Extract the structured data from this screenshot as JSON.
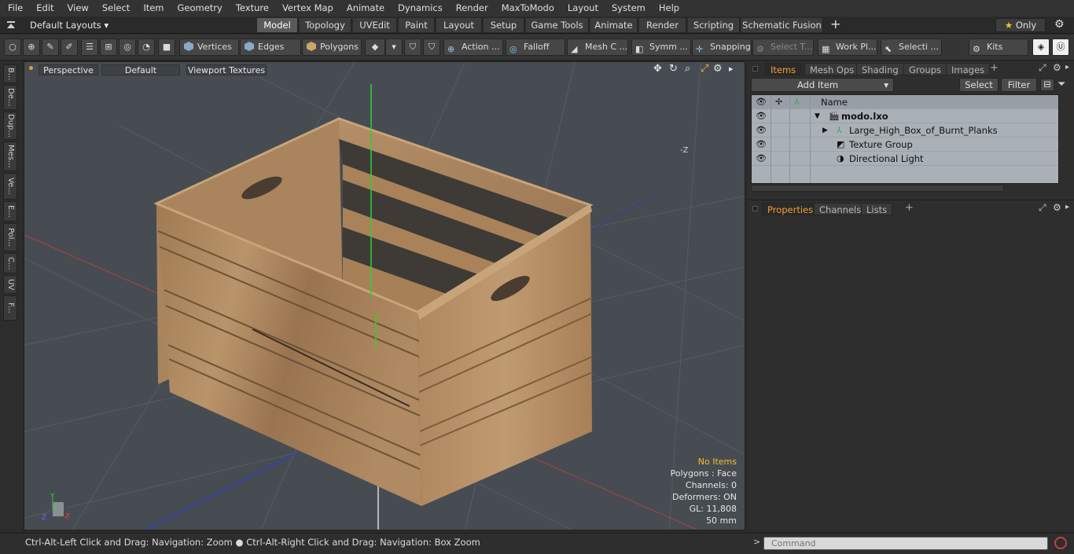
{
  "menu": [
    "File",
    "Edit",
    "View",
    "Select",
    "Item",
    "Geometry",
    "Texture",
    "Vertex Map",
    "Animate",
    "Dynamics",
    "Render",
    "MaxToModo",
    "Layout",
    "System",
    "Help"
  ],
  "layout_selector": "Default Layouts",
  "layout_tabs": [
    {
      "label": "Model",
      "active": true
    },
    {
      "label": "Topology"
    },
    {
      "label": "UVEdit"
    },
    {
      "label": "Paint"
    },
    {
      "label": "Layout"
    },
    {
      "label": "Setup"
    },
    {
      "label": "Game Tools"
    },
    {
      "label": "Animate"
    },
    {
      "label": "Render"
    },
    {
      "label": "Scripting"
    },
    {
      "label": "Schematic Fusion"
    }
  ],
  "only_label": "Only",
  "toolbar": {
    "vertices": "Vertices",
    "edges": "Edges",
    "polygons": "Polygons",
    "action": "Action ...",
    "falloff": "Falloff",
    "mesh": "Mesh C ...",
    "symm": "Symm ...",
    "snapping": "Snapping",
    "select_t": "Select T...",
    "work_pl": "Work Pl...",
    "selecti": "Selecti ...",
    "kits": "Kits"
  },
  "left_tabs": [
    "B...",
    "De...",
    "Dup...",
    "Mes...",
    "Ve...",
    "E...",
    "Pol...",
    "C...",
    "UV",
    "F..."
  ],
  "viewport": {
    "perspective": "Perspective",
    "default": "Default",
    "textures": "Viewport Textures",
    "axis_label": "-Z",
    "info": {
      "items": "No Items",
      "polygons": "Polygons : Face",
      "channels": "Channels: 0",
      "deformers": "Deformers: ON",
      "gl": "GL: 11,808",
      "scale": "50 mm"
    },
    "gizmo": {
      "y": "Y",
      "z": "Z",
      "x": "X"
    }
  },
  "items_panel": {
    "tabs": [
      "Items",
      "Mesh Ops",
      "Shading",
      "Groups",
      "Images"
    ],
    "add_item": "Add Item",
    "select": "Select",
    "filter": "Filter",
    "column_name": "Name",
    "rows": [
      "modo.lxo",
      "Large_High_Box_of_Burnt_Planks",
      "Texture Group",
      "Directional Light"
    ]
  },
  "properties_panel": {
    "tabs": [
      "Properties",
      "Channels",
      "Lists"
    ]
  },
  "status": {
    "left": "Ctrl-Alt-Left Click and Drag: Navigation: Zoom",
    "right": "Ctrl-Alt-Right Click and Drag: Navigation: Box Zoom"
  },
  "command": {
    "prompt": ">",
    "placeholder": "Command"
  },
  "colors": {
    "accent": "#f0a030",
    "wood_light": "#b48a5e",
    "wood_dark": "#8a6a48",
    "viewport_bg": "#474c52"
  }
}
